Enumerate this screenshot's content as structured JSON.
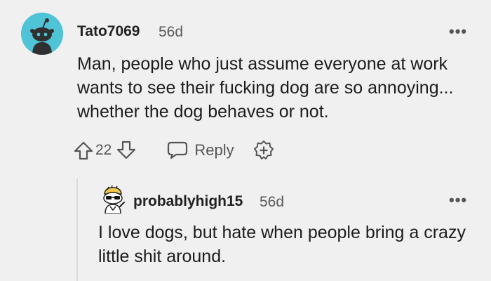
{
  "comment": {
    "username": "Tato7069",
    "time": "56d",
    "more": "•••",
    "body": "Man, people who just assume everyone at work wants to see their fucking dog are so annoying... whether the dog behaves or not.",
    "vote_count": "22",
    "reply_label": "Reply"
  },
  "reply": {
    "username": "probablyhigh15",
    "time": "56d",
    "more": "•••",
    "body": "I love dogs, but hate when people bring a crazy little shit around."
  },
  "colors": {
    "background": "#f0f0f0",
    "avatar_bg": "#4fc4d7",
    "muted_text": "#595959",
    "icon_gray": "#555555"
  },
  "icons": [
    "snoo-avatar-icon",
    "upvote-icon",
    "downvote-icon",
    "reply-bubble-icon",
    "award-plus-icon",
    "snoo-sunglasses-avatar-icon"
  ]
}
